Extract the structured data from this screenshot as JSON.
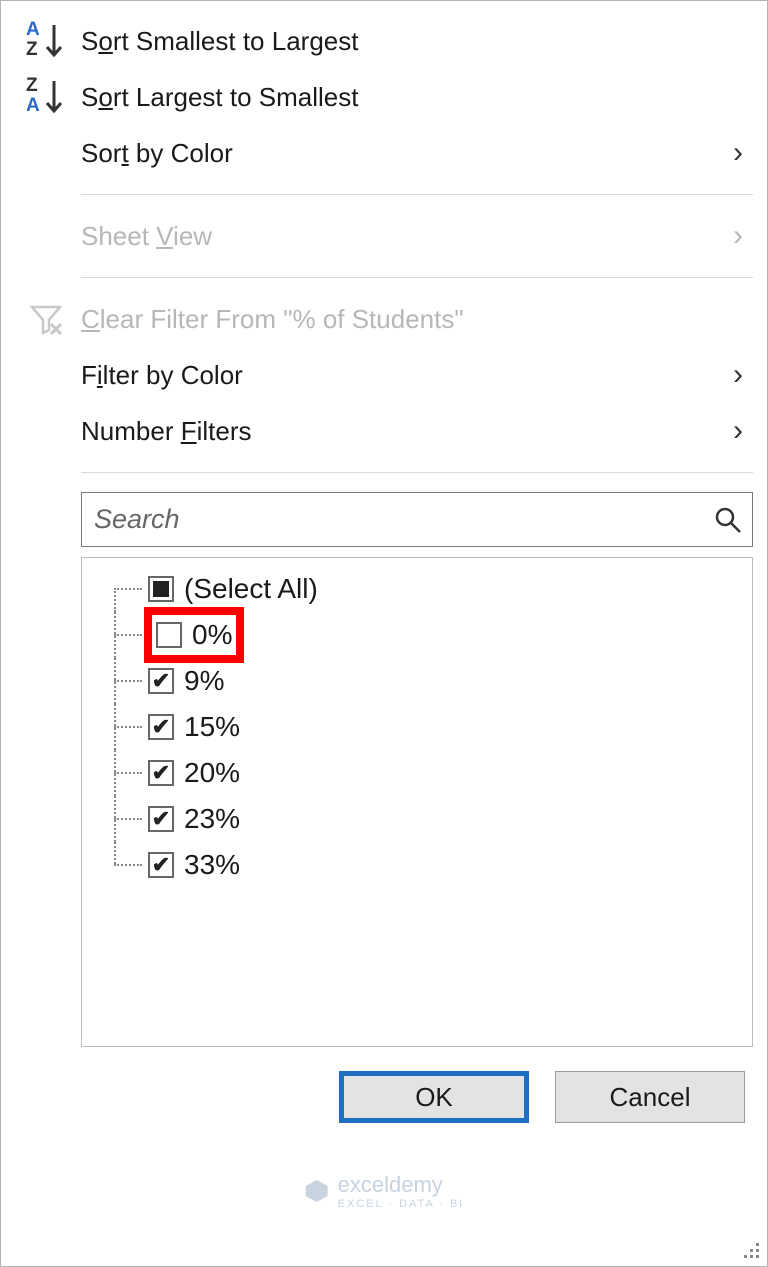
{
  "sort_asc": {
    "pre": "S",
    "u": "o",
    "post": "rt Smallest to Largest"
  },
  "sort_desc": {
    "pre": "S",
    "u": "o",
    "post": "rt Largest to Smallest"
  },
  "sort_color": {
    "pre": "Sor",
    "u": "t",
    "post": " by Color"
  },
  "sheet_view": {
    "pre": "Sheet ",
    "u": "V",
    "post": "iew"
  },
  "clear_filter": {
    "pre": "",
    "u": "C",
    "post": "lear Filter From \"% of Students\""
  },
  "filter_color": {
    "pre": "F",
    "u": "i",
    "post": "lter by Color"
  },
  "number_filters": {
    "pre": "Number ",
    "u": "F",
    "post": "ilters"
  },
  "search_placeholder": "Search",
  "tree": {
    "select_all": "(Select All)",
    "items": [
      {
        "label": "0%",
        "checked": false
      },
      {
        "label": "9%",
        "checked": true
      },
      {
        "label": "15%",
        "checked": true
      },
      {
        "label": "20%",
        "checked": true
      },
      {
        "label": "23%",
        "checked": true
      },
      {
        "label": "33%",
        "checked": true
      }
    ]
  },
  "buttons": {
    "ok": "OK",
    "cancel": "Cancel"
  },
  "watermark": {
    "brand": "exceldemy",
    "tag": "EXCEL · DATA · BI"
  }
}
